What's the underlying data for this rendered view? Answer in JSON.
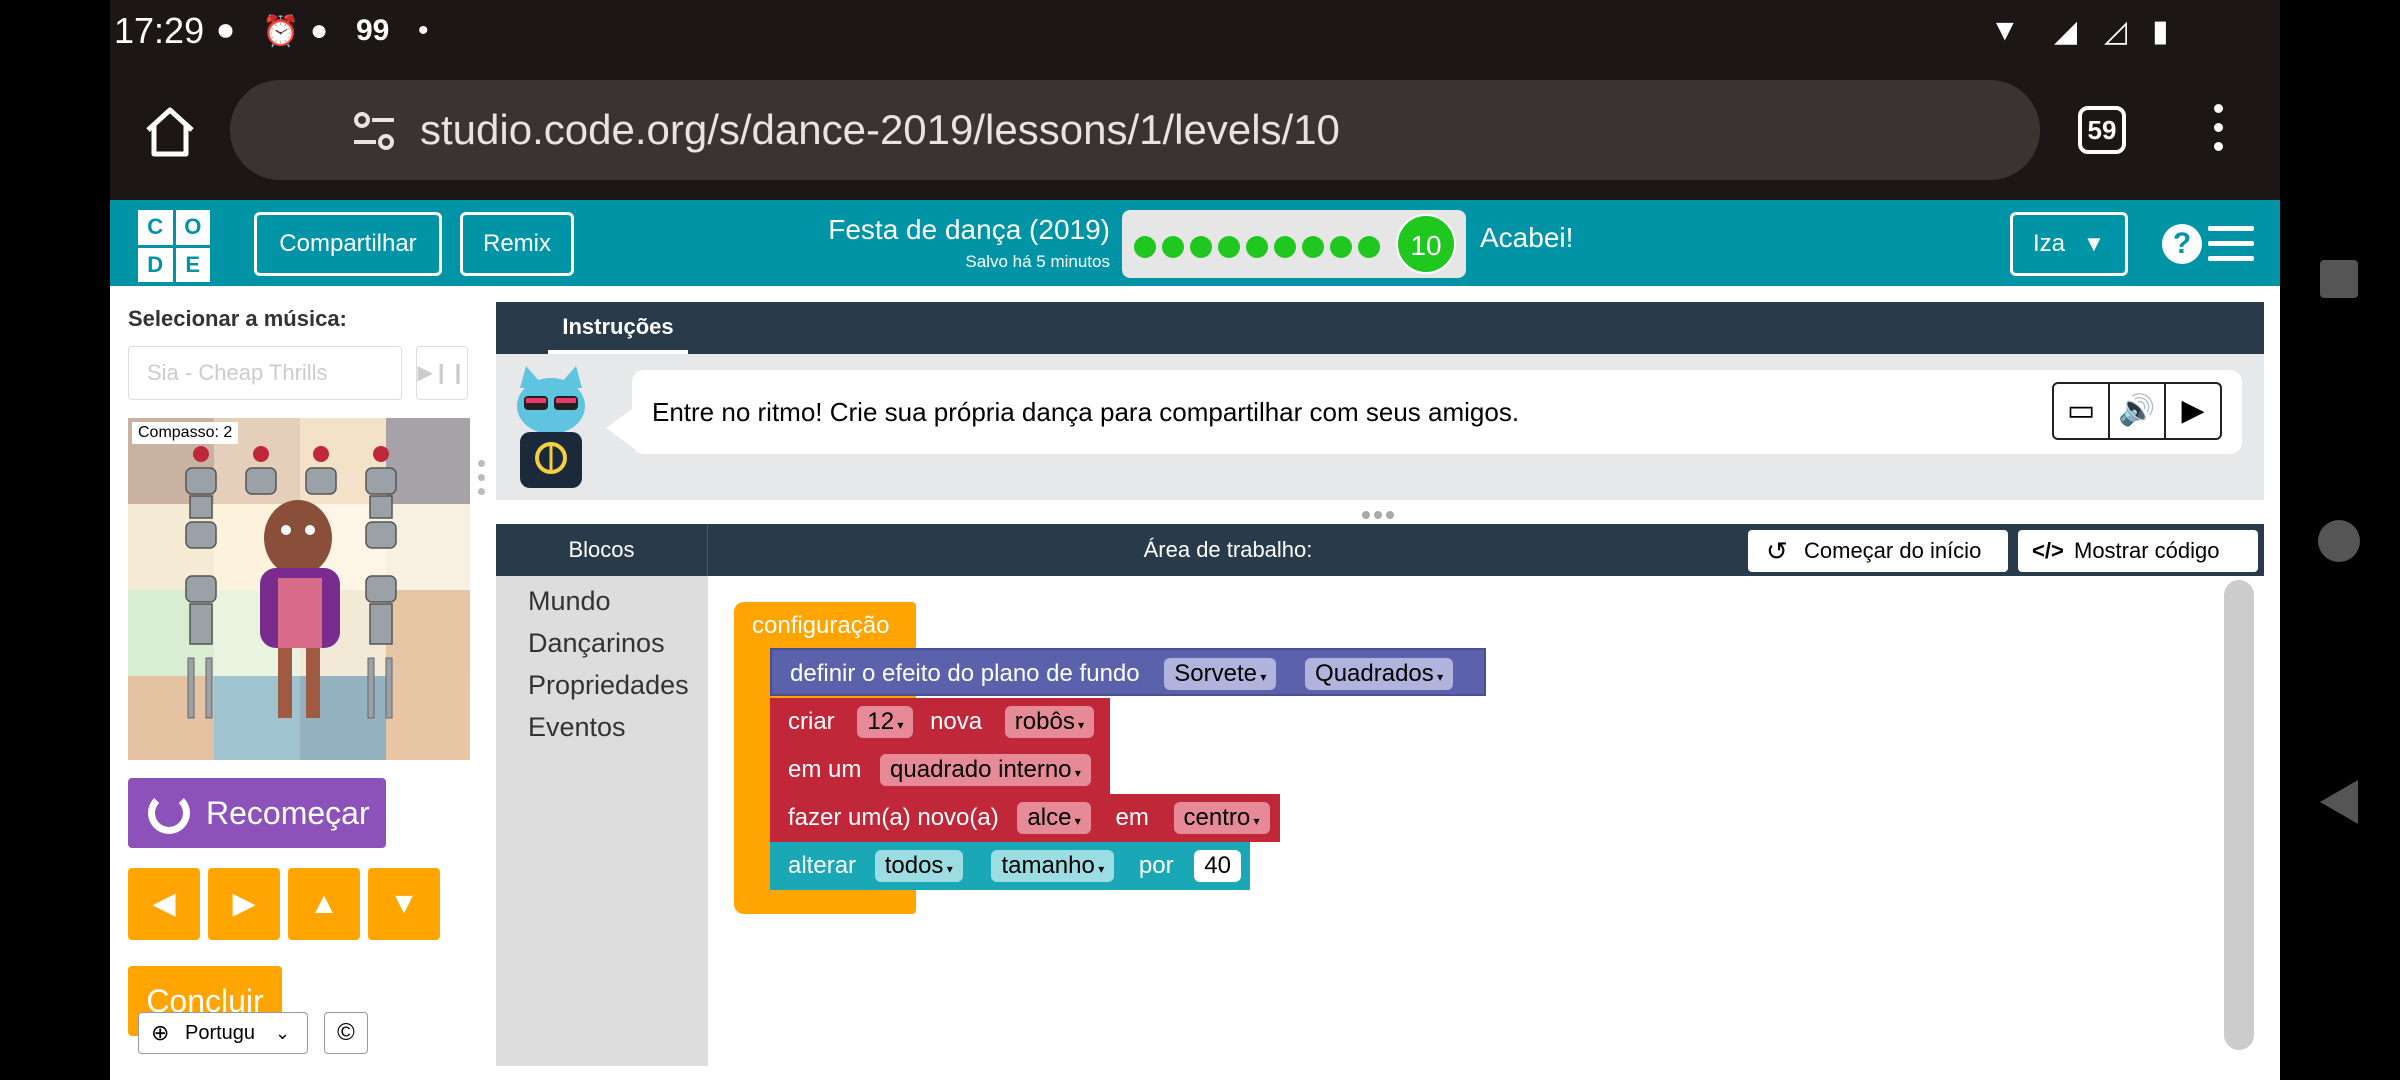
{
  "statusbar": {
    "time": "17:29",
    "notif_count": "99"
  },
  "browser": {
    "url": "studio.code.org/s/dance-2019/lessons/1/levels/10",
    "tab_count": "59"
  },
  "header": {
    "logo_letters": [
      "C",
      "O",
      "D",
      "E"
    ],
    "share_label": "Compartilhar",
    "remix_label": "Remix",
    "lesson_title": "Festa de dança (2019)",
    "saved_text": "Salvo há 5 minutos",
    "progress": {
      "completed_dots": 9,
      "current_level": "10"
    },
    "done_label": "Acabei!",
    "user_name": "Iza",
    "help_symbol": "?"
  },
  "left_panel": {
    "music_label": "Selecionar a música:",
    "song_value": "Sia - Cheap Thrills",
    "measure_text": "Compasso: 2",
    "restart_label": "Recomeçar",
    "finish_label": "Concluir",
    "language_label": "Portugu",
    "copyright_symbol": "©"
  },
  "instructions": {
    "tab_label": "Instruções",
    "text": "Entre no ritmo! Crie sua própria dança para compartilhar com seus amigos."
  },
  "workspace": {
    "blocks_tab": "Blocos",
    "title": "Área de trabalho:",
    "start_over_label": "Começar do início",
    "show_code_label": "Mostrar código",
    "toolbox": [
      "Mundo",
      "Dançarinos",
      "Propriedades",
      "Eventos"
    ],
    "setup_label": "configuração",
    "block1": {
      "text": "definir o efeito do plano de fundo",
      "opt1": "Sorvete",
      "opt2": "Quadrados"
    },
    "block2": {
      "w1": "criar",
      "num": "12",
      "w2": "nova",
      "opt": "robôs"
    },
    "block3": {
      "w1": "em um",
      "opt": "quadrado interno"
    },
    "block4": {
      "w1": "fazer um(a) novo(a)",
      "opt1": "alce",
      "w2": "em",
      "opt2": "centro"
    },
    "block5": {
      "w1": "alterar",
      "opt1": "todos",
      "opt2": "tamanho",
      "w2": "por",
      "num": "40"
    }
  },
  "colors": {
    "brand_teal": "#0094a6",
    "navy": "#293a4b",
    "setup_orange": "#ffa400",
    "world_purple": "#5b62ab",
    "dancer_red": "#c0283a",
    "prop_teal": "#1aa8b6",
    "progress_green": "#1fc71f"
  }
}
